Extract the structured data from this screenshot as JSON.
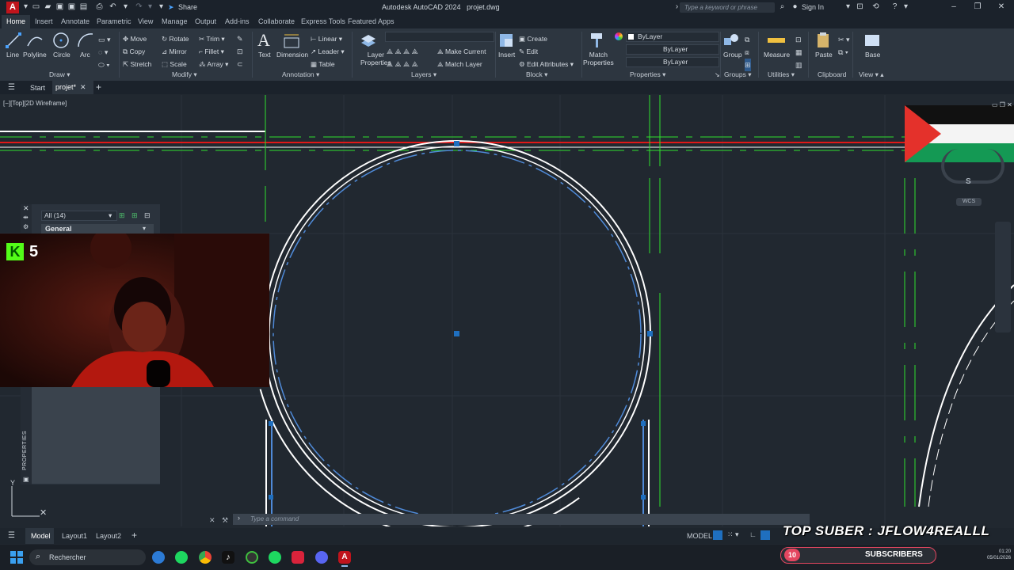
{
  "titlebar": {
    "app_title": "Autodesk AutoCAD 2024",
    "file_name": "projet.dwg",
    "share_label": "Share",
    "search_placeholder": "Type a keyword or phrase",
    "sign_in": "Sign In"
  },
  "ribbon_tabs": [
    "Home",
    "Insert",
    "Annotate",
    "Parametric",
    "View",
    "Manage",
    "Output",
    "Add-ins",
    "Collaborate",
    "Express Tools",
    "Featured Apps"
  ],
  "ribbon": {
    "draw": {
      "label": "Draw",
      "line": "Line",
      "polyline": "Polyline",
      "circle": "Circle",
      "arc": "Arc"
    },
    "modify": {
      "label": "Modify",
      "move": "Move",
      "rotate": "Rotate",
      "trim": "Trim",
      "copy": "Copy",
      "mirror": "Mirror",
      "fillet": "Fillet",
      "stretch": "Stretch",
      "scale": "Scale",
      "array": "Array"
    },
    "annotation": {
      "label": "Annotation",
      "text": "Text",
      "dimension": "Dimension",
      "linear": "Linear",
      "leader": "Leader",
      "table": "Table"
    },
    "layers": {
      "label": "Layers",
      "layer_properties_1": "Layer",
      "layer_properties_2": "Properties",
      "make_current": "Make Current",
      "match_layer": "Match Layer"
    },
    "block": {
      "label": "Block",
      "insert": "Insert",
      "create": "Create",
      "edit": "Edit",
      "edit_attributes": "Edit Attributes"
    },
    "properties": {
      "label": "Properties",
      "match_properties_1": "Match",
      "match_properties_2": "Properties",
      "color": "ByLayer",
      "linetype": "ByLayer",
      "lineweight": "ByLayer"
    },
    "groups": {
      "label": "Groups",
      "group": "Group"
    },
    "utilities": {
      "label": "Utilities",
      "measure": "Measure"
    },
    "clipboard": {
      "label": "Clipboard",
      "paste": "Paste"
    },
    "view": {
      "label": "View",
      "base": "Base"
    }
  },
  "file_tabs": {
    "start": "Start",
    "projet": "projet*"
  },
  "viewport": {
    "label": "[−][Top][2D Wireframe]"
  },
  "viewcube": {
    "compass_s": "S",
    "wcs": "WCS"
  },
  "palette": {
    "filter": "All (14)",
    "category": "General",
    "side_label": "PROPERTIES"
  },
  "webcam": {
    "kick_count": "5"
  },
  "command": {
    "placeholder": "Type a command"
  },
  "status": {
    "model_tab": "Model",
    "layout1": "Layout1",
    "layout2": "Layout2",
    "model_button": "MODEL"
  },
  "taskbar": {
    "search": "Rechercher",
    "time": "01:20",
    "date": "05/01/2026"
  },
  "overlay": {
    "top_suber": "TOP SUBER : JFLOW4REALLL",
    "subs_count": "10",
    "subs_label": "SUBSCRIBERS"
  },
  "colors": {
    "accent": "#1f6fbf",
    "line_green": "#2ee02e",
    "line_red": "#e01818",
    "line_blue": "#4f8ad8",
    "palestine_red": "#e4312b",
    "palestine_green": "#149954"
  }
}
